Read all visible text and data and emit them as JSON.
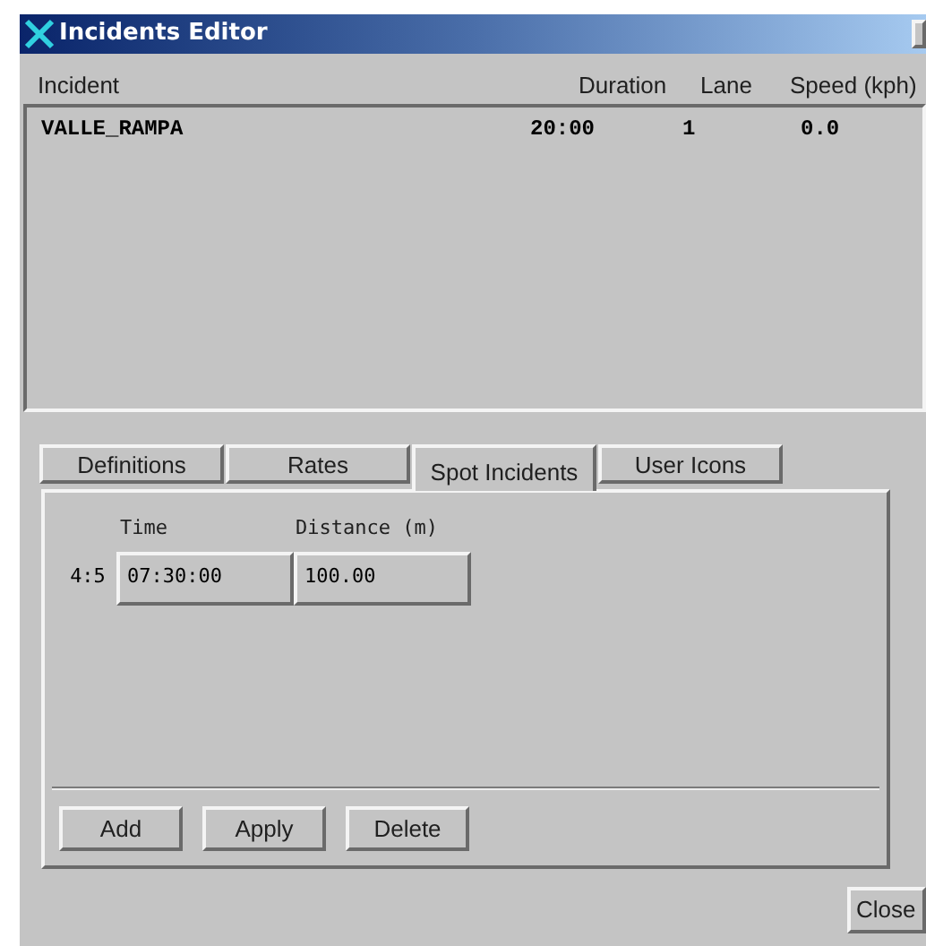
{
  "window": {
    "title": "Incidents Editor"
  },
  "incidents": {
    "columns": [
      "Incident",
      "Duration",
      "Lane",
      "Speed (kph)"
    ],
    "rows": [
      {
        "cells": [
          "VALLE_RAMPA",
          "20:00",
          "1",
          "0.0"
        ]
      }
    ]
  },
  "tabs": [
    {
      "label": "Definitions",
      "selected": false
    },
    {
      "label": "Rates",
      "selected": false
    },
    {
      "label": "Spot Incidents",
      "selected": true
    },
    {
      "label": "User Icons",
      "selected": false
    }
  ],
  "spot_table": {
    "columns": [
      "Time",
      "Distance (m)"
    ],
    "rows": [
      {
        "label": "4:5",
        "cells": [
          "07:30:00",
          "100.00"
        ]
      }
    ]
  },
  "panel_buttons": [
    "Add",
    "Apply",
    "Delete"
  ],
  "close_button": "Close"
}
